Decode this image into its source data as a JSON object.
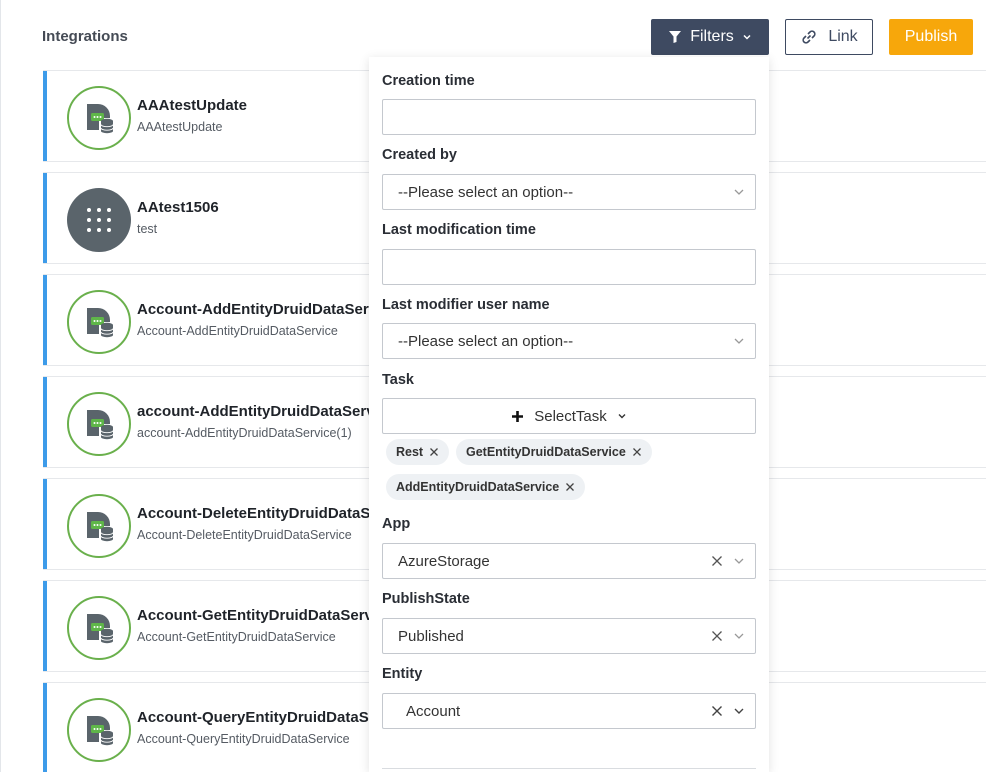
{
  "page": {
    "title": "Integrations"
  },
  "toolbar": {
    "filters_label": "Filters",
    "link_label": "Link",
    "publish_label": "Publish"
  },
  "integrations": [
    {
      "name": "AAAtestUpdate",
      "subtitle": "AAAtestUpdate",
      "icon": "data-service-icon"
    },
    {
      "name": "AAtest1506",
      "subtitle": "test",
      "icon": "dots-grid-icon"
    },
    {
      "name": "Account-AddEntityDruidDataServ",
      "subtitle": "Account-AddEntityDruidDataService",
      "icon": "data-service-icon"
    },
    {
      "name": "account-AddEntityDruidDataServ",
      "subtitle": "account-AddEntityDruidDataService(1)",
      "icon": "data-service-icon"
    },
    {
      "name": "Account-DeleteEntityDruidDataSe",
      "subtitle": "Account-DeleteEntityDruidDataService",
      "icon": "data-service-icon"
    },
    {
      "name": "Account-GetEntityDruidDataServ",
      "subtitle": "Account-GetEntityDruidDataService",
      "icon": "data-service-icon"
    },
    {
      "name": "Account-QueryEntityDruidDataSe",
      "subtitle": "Account-QueryEntityDruidDataService",
      "icon": "data-service-icon"
    }
  ],
  "filters": {
    "creation_time": {
      "label": "Creation time",
      "value": ""
    },
    "created_by": {
      "label": "Created by",
      "value": "--Please select an option--"
    },
    "last_modification_time": {
      "label": "Last modification time",
      "value": ""
    },
    "last_modifier": {
      "label": "Last modifier user name",
      "value": "--Please select an option--"
    },
    "task": {
      "label": "Task",
      "button_label": "SelectTask",
      "chips": [
        "Rest",
        "GetEntityDruidDataService",
        "AddEntityDruidDataService"
      ]
    },
    "app": {
      "label": "App",
      "value": "AzureStorage"
    },
    "publish_state": {
      "label": "PublishState",
      "value": "Published"
    },
    "entity": {
      "label": "Entity",
      "value": "Account"
    }
  },
  "colors": {
    "filters_button": "#3e4a61",
    "publish_button": "#f7a70b",
    "card_accent": "#3d9be9",
    "avatar_ring": "#6ab04c"
  }
}
